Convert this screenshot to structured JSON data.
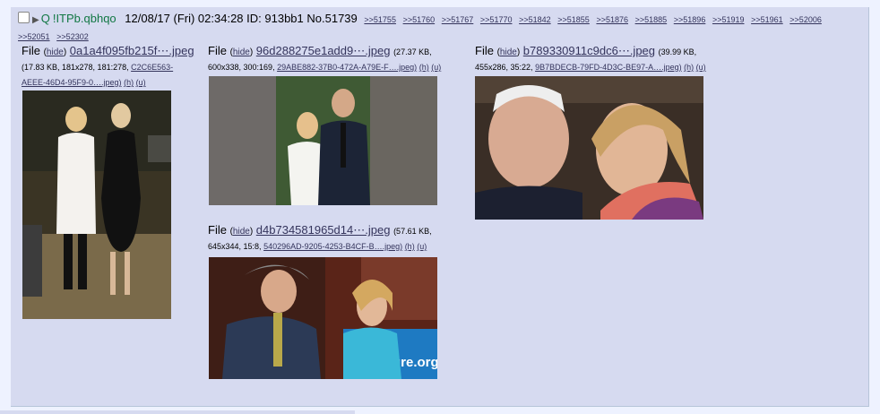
{
  "post": {
    "name": "Q",
    "tripcode": "!ITPb.qbhqo",
    "datetime": "12/08/17 (Fri) 02:34:28",
    "id_label": "ID: 913bb1",
    "number": "No.51739",
    "backlinks": [
      ">>51755",
      ">>51760",
      ">>51767",
      ">>51770",
      ">>51842",
      ">>51855",
      ">>51876",
      ">>51885",
      ">>51896",
      ">>51919",
      ">>51961",
      ">>52006",
      ">>52051",
      ">>52302"
    ]
  },
  "files": [
    {
      "file_label": "File",
      "hide": "hide",
      "filename": "0a1a4f095fb215f⋯.jpeg",
      "meta1": "(17.83 KB, 181x278, 181:278,",
      "hash_a": "C2C6E563-",
      "hash_b": "AEEE-46D4-95F9-0….jpeg)",
      "h": "(h)",
      "u": "(u)",
      "thumb_desc": "Two women standing at an evening event"
    },
    {
      "file_label": "File",
      "hide": "hide",
      "filename": "96d288275e1add9⋯.jpeg",
      "meta1": "(27.37 KB,",
      "meta2": "600x338, 300:169,",
      "hash": "29ABE882-37B0-472A-A79E-F….jpeg)",
      "h": "(h)",
      "u": "(u)",
      "thumb_desc": "Woman in white and man in suit"
    },
    {
      "file_label": "File",
      "hide": "hide",
      "filename": "b789330911c9dc6⋯.jpeg",
      "meta1": "(39.99 KB,",
      "meta2": "455x286, 35:22,",
      "hash": "9B7BDECB-79FD-4D3C-BE97-A….jpeg)",
      "h": "(h)",
      "u": "(u)",
      "thumb_desc": "Older man and woman face to face"
    },
    {
      "file_label": "File",
      "hide": "hide",
      "filename": "d4b734581965d14⋯.jpeg",
      "meta1": "(57.61 KB,",
      "meta2": "645x344, 15:8,",
      "hash": "540296AD-9205-4253-B4CF-B….jpeg)",
      "h": "(h)",
      "u": "(u)",
      "banner_text": "ure.org",
      "thumb_desc": "Man in suit greeting woman in blue"
    }
  ]
}
